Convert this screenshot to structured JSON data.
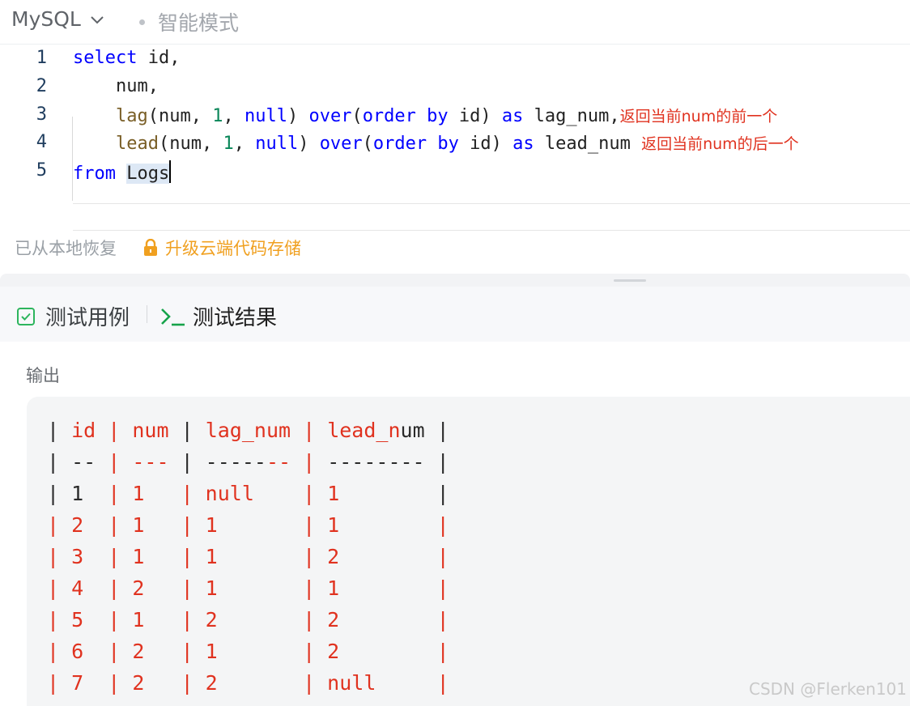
{
  "header": {
    "language": "MySQL",
    "mode": "智能模式"
  },
  "editor": {
    "line_numbers": [
      "1",
      "2",
      "3",
      "4",
      "5"
    ],
    "lines": [
      [
        {
          "t": "select",
          "c": "kw"
        },
        {
          "t": " id,",
          "c": "txt"
        }
      ],
      [
        {
          "t": "    num,",
          "c": "txt"
        }
      ],
      [
        {
          "t": "    ",
          "c": "txt"
        },
        {
          "t": "lag",
          "c": "fn"
        },
        {
          "t": "(num, ",
          "c": "txt"
        },
        {
          "t": "1",
          "c": "num"
        },
        {
          "t": ", ",
          "c": "txt"
        },
        {
          "t": "null",
          "c": "kw"
        },
        {
          "t": ") ",
          "c": "txt"
        },
        {
          "t": "over",
          "c": "kw"
        },
        {
          "t": "(",
          "c": "txt"
        },
        {
          "t": "order by",
          "c": "kw"
        },
        {
          "t": " id) ",
          "c": "txt"
        },
        {
          "t": "as",
          "c": "kw"
        },
        {
          "t": " lag_num,",
          "c": "txt"
        },
        {
          "t": "返回当前num的前一个",
          "c": "cmt"
        }
      ],
      [
        {
          "t": "    ",
          "c": "txt"
        },
        {
          "t": "lead",
          "c": "fn"
        },
        {
          "t": "(num, ",
          "c": "txt"
        },
        {
          "t": "1",
          "c": "num"
        },
        {
          "t": ", ",
          "c": "txt"
        },
        {
          "t": "null",
          "c": "kw"
        },
        {
          "t": ") ",
          "c": "txt"
        },
        {
          "t": "over",
          "c": "kw"
        },
        {
          "t": "(",
          "c": "txt"
        },
        {
          "t": "order by",
          "c": "kw"
        },
        {
          "t": " id) ",
          "c": "txt"
        },
        {
          "t": "as",
          "c": "kw"
        },
        {
          "t": " lead_num ",
          "c": "txt"
        },
        {
          "t": "返回当前num的后一个",
          "c": "cmt"
        }
      ],
      [
        {
          "t": "from",
          "c": "kw"
        },
        {
          "t": " ",
          "c": "txt"
        },
        {
          "t": "Logs",
          "c": "hl"
        },
        {
          "t": "",
          "c": "cursor"
        }
      ]
    ]
  },
  "status": {
    "restored": "已从本地恢复",
    "upgrade": "升级云端代码存储"
  },
  "tabs": {
    "testcase": "测试用例",
    "result": "测试结果"
  },
  "output": {
    "label": "输出",
    "lines": [
      [
        {
          "t": "| ",
          "c": "b"
        },
        {
          "t": "id",
          "c": "r"
        },
        {
          "t": " | ",
          "c": "r"
        },
        {
          "t": "num",
          "c": "r"
        },
        {
          "t": " | ",
          "c": "b"
        },
        {
          "t": "lag_num",
          "c": "r"
        },
        {
          "t": " | ",
          "c": "r"
        },
        {
          "t": "lead_n",
          "c": "r"
        },
        {
          "t": "um |",
          "c": "b"
        }
      ],
      [
        {
          "t": "| -- ",
          "c": "b"
        },
        {
          "t": "| --- ",
          "c": "r"
        },
        {
          "t": "| -----",
          "c": "b"
        },
        {
          "t": "--",
          "c": "r"
        },
        {
          "t": " | ",
          "c": "r"
        },
        {
          "t": "-------- |",
          "c": "b"
        }
      ],
      [
        {
          "t": "| 1  ",
          "c": "b"
        },
        {
          "t": "| 1   | null    | 1        ",
          "c": "r"
        },
        {
          "t": "|",
          "c": "b"
        }
      ],
      [
        {
          "t": "| 2  | 1   | 1       | 1        |",
          "c": "r"
        }
      ],
      [
        {
          "t": "| 3  | 1   | 1       | 2        |",
          "c": "r"
        }
      ],
      [
        {
          "t": "| 4  | 2   | 1       | 1        |",
          "c": "r"
        }
      ],
      [
        {
          "t": "| 5  | 1   | 2       | 2        |",
          "c": "r"
        }
      ],
      [
        {
          "t": "| 6  | 2   | 1       | 2        |",
          "c": "r"
        }
      ],
      [
        {
          "t": "| 7  | 2   | 2       | null     |",
          "c": "r"
        }
      ]
    ]
  },
  "watermark": "CSDN @Flerken101"
}
